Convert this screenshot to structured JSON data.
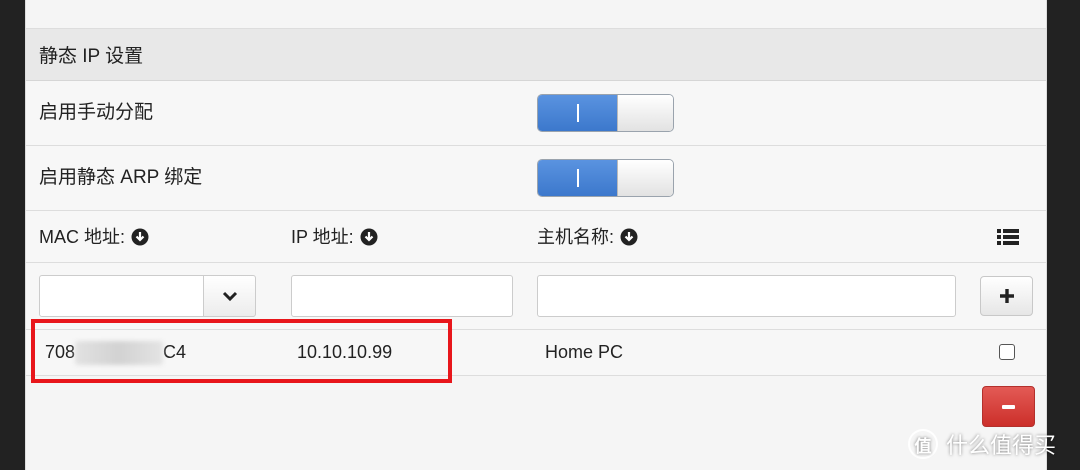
{
  "section": {
    "title": "静态 IP 设置"
  },
  "settings": [
    {
      "label": "启用手动分配",
      "enabled": true
    },
    {
      "label": "启用静态 ARP 绑定",
      "enabled": true
    }
  ],
  "table": {
    "columns": [
      "MAC 地址:",
      "IP 地址:",
      "主机名称:"
    ],
    "new_entry": {
      "mac": "",
      "ip": "",
      "hostname": ""
    },
    "rows": [
      {
        "mac_prefix": "708",
        "mac_suffix": "C4",
        "ip": "10.10.10.99",
        "hostname": "Home PC",
        "checked": false
      }
    ]
  },
  "watermark": {
    "text": "什么值得买",
    "logo": "值"
  },
  "colors": {
    "accent": "#3c78cc",
    "danger": "#cc2f2a",
    "highlight": "#e8161b"
  },
  "icons": [
    "sort-down-circle-icon",
    "chevron-down-icon",
    "plus-icon",
    "list-icon",
    "minus-icon"
  ]
}
